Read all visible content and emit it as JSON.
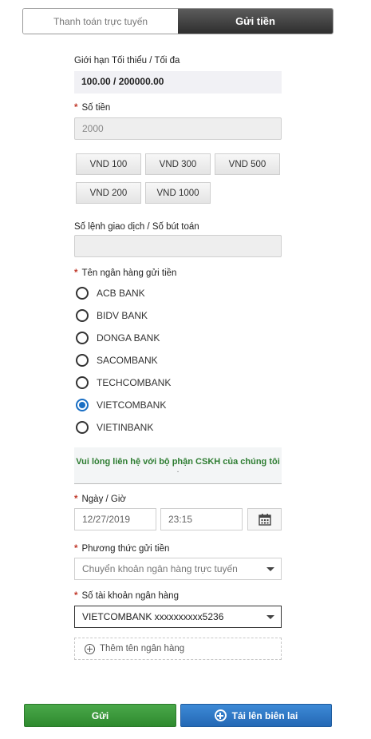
{
  "tabs": {
    "online": "Thanh toán trực tuyến",
    "deposit": "Gửi tiền"
  },
  "limit": {
    "label": "Giới hạn Tối thiểu / Tối đa",
    "value": "100.00 / 200000.00"
  },
  "amount": {
    "required": "*",
    "label": "Số tiền",
    "value": "2000"
  },
  "quick_amounts": [
    "VND 100",
    "VND 300",
    "VND 500",
    "VND 200",
    "VND 1000"
  ],
  "transaction": {
    "label": "Số lệnh giao dịch / Số bút toán",
    "value": ""
  },
  "bank": {
    "required": "*",
    "label": "Tên ngân hàng gửi tiền",
    "options": [
      "ACB BANK",
      "BIDV BANK",
      "DONGA BANK",
      "SACOMBANK",
      "TECHCOMBANK",
      "VIETCOMBANK",
      "VIETINBANK"
    ],
    "selected": "VIETCOMBANK"
  },
  "notice": {
    "text": "Vui lòng liên hệ với bộ phận CSKH của chúng tôi",
    "dot": "."
  },
  "datetime": {
    "required": "*",
    "label": "Ngày / Giờ",
    "date": "12/27/2019",
    "time": "23:15",
    "calendar_icon": "calendar-icon"
  },
  "method": {
    "required": "*",
    "label": "Phương thức gửi tiền",
    "value": "Chuyển khoản ngân hàng trực tuyến"
  },
  "account": {
    "required": "*",
    "label": "Số tài khoản ngân hàng",
    "value": "VIETCOMBANK xxxxxxxxxx5236"
  },
  "add_bank": {
    "label": "Thêm tên ngân hàng",
    "icon": "plus-circle-icon"
  },
  "buttons": {
    "submit": "Gửi",
    "upload": "Tải lên biên lai",
    "upload_icon": "plus-circle-icon"
  },
  "colors": {
    "submit": "#3a9a3a",
    "upload": "#2f78c4",
    "selected_radio": "#1a6fc4",
    "notice_text": "#2e7d32",
    "required": "#c0392b"
  }
}
